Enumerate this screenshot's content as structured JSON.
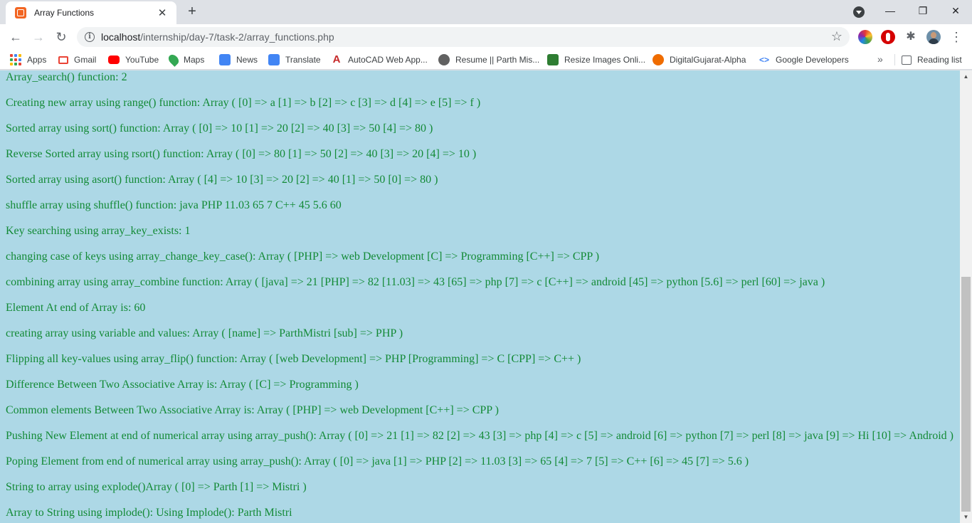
{
  "tab": {
    "title": "Array Functions",
    "close": "✕"
  },
  "newtab": "+",
  "window": {
    "minimize": "—",
    "restore": "❐",
    "close": "✕"
  },
  "address": {
    "host": "localhost",
    "path": "/internship/day-7/task-2/array_functions.php"
  },
  "bookmarks": [
    {
      "label": "Apps",
      "icon": "apps-grid-icon"
    },
    {
      "label": "Gmail",
      "icon": "gmail-icon",
      "color": "#ea4335"
    },
    {
      "label": "YouTube",
      "icon": "youtube-icon",
      "color": "#ff0000"
    },
    {
      "label": "Maps",
      "icon": "maps-icon",
      "color": "#34a853"
    },
    {
      "label": "News",
      "icon": "news-icon",
      "color": "#4285f4"
    },
    {
      "label": "Translate",
      "icon": "translate-icon",
      "color": "#4285f4"
    },
    {
      "label": "AutoCAD Web App...",
      "icon": "autocad-icon",
      "color": "#c62828"
    },
    {
      "label": "Resume || Parth Mis...",
      "icon": "resume-icon",
      "color": "#424242"
    },
    {
      "label": "Resize Images Onli...",
      "icon": "resize-icon",
      "color": "#2e7d32"
    },
    {
      "label": "DigitalGujarat-Alpha",
      "icon": "digitalgujarat-icon",
      "color": "#ef6c00"
    },
    {
      "label": "Google Developers",
      "icon": "google-developers-icon",
      "color": "#4285f4"
    }
  ],
  "bookmarks_more": "»",
  "reading_list": "Reading list",
  "content_lines": [
    "Array_search() function: 2",
    "Creating new array using range() function: Array ( [0] => a [1] => b [2] => c [3] => d [4] => e [5] => f )",
    "Sorted array using sort() function: Array ( [0] => 10 [1] => 20 [2] => 40 [3] => 50 [4] => 80 )",
    "Reverse Sorted array using rsort() function: Array ( [0] => 80 [1] => 50 [2] => 40 [3] => 20 [4] => 10 )",
    "Sorted array using asort() function: Array ( [4] => 10 [3] => 20 [2] => 40 [1] => 50 [0] => 80 )",
    "shuffle array using shuffle() function: java PHP 11.03 65 7 C++ 45 5.6 60",
    "Key searching using array_key_exists: 1",
    "changing case of keys using array_change_key_case(): Array ( [PHP] => web Development [C] => Programming [C++] => CPP )",
    "combining array using array_combine function: Array ( [java] => 21 [PHP] => 82 [11.03] => 43 [65] => php [7] => c [C++] => android [45] => python [5.6] => perl [60] => java )",
    "Element At end of Array is: 60",
    "creating array using variable and values: Array ( [name] => ParthMistri [sub] => PHP )",
    "Flipping all key-values using array_flip() function: Array ( [web Development] => PHP [Programming] => C [CPP] => C++ )",
    "Difference Between Two Associative Array is: Array ( [C] => Programming )",
    "Common elements Between Two Associative Array is: Array ( [PHP] => web Development [C++] => CPP )",
    "Pushing New Element at end of numerical array using array_push(): Array ( [0] => 21 [1] => 82 [2] => 43 [3] => php [4] => c [5] => android [6] => python [7] => perl [8] => java [9] => Hi [10] => Android )",
    "Poping Element from end of numerical array using array_push(): Array ( [0] => java [1] => PHP [2] => 11.03 [3] => 65 [4] => 7 [5] => C++ [6] => 45 [7] => 5.6 )",
    "String to array using explode()Array ( [0] => Parth [1] => Mistri )",
    "Array to String using implode(): Using Implode(): Parth Mistri"
  ],
  "colors": {
    "page_background": "#add8e6",
    "text": "#138a36"
  }
}
